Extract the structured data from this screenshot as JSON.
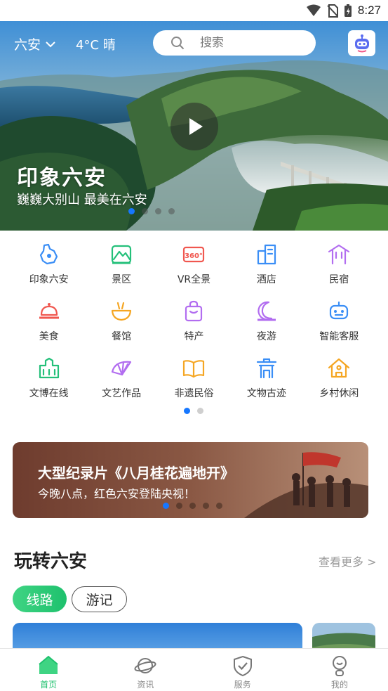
{
  "status_bar": {
    "time": "8:27"
  },
  "header": {
    "city": "六安",
    "weather": "4°C 晴",
    "search_placeholder": "搜索"
  },
  "hero": {
    "title": "印象六安",
    "subtitle": "巍巍大别山  最美在六安",
    "slide_count": 4,
    "active_slide": 0
  },
  "grid": {
    "rows": [
      [
        {
          "label": "印象六安",
          "icon": "map-region-icon",
          "color": "#3a8ef6"
        },
        {
          "label": "景区",
          "icon": "mountain-icon",
          "color": "#24c07a"
        },
        {
          "label": "VR全景",
          "icon": "vr-360-icon",
          "color": "#f0574f"
        },
        {
          "label": "酒店",
          "icon": "building-icon",
          "color": "#3a8ef6"
        },
        {
          "label": "民宿",
          "icon": "pavilion-icon",
          "color": "#b26df0"
        }
      ],
      [
        {
          "label": "美食",
          "icon": "cloche-icon",
          "color": "#f0574f"
        },
        {
          "label": "餐馆",
          "icon": "bowl-icon",
          "color": "#f5a623"
        },
        {
          "label": "特产",
          "icon": "gift-bag-icon",
          "color": "#b26df0"
        },
        {
          "label": "夜游",
          "icon": "moon-icon",
          "color": "#b26df0"
        },
        {
          "label": "智能客服",
          "icon": "robot-icon",
          "color": "#3a8ef6"
        }
      ],
      [
        {
          "label": "文博在线",
          "icon": "museum-icon",
          "color": "#24c07a"
        },
        {
          "label": "文艺作品",
          "icon": "fan-icon",
          "color": "#b26df0"
        },
        {
          "label": "非遗民俗",
          "icon": "book-icon",
          "color": "#f5a623"
        },
        {
          "label": "文物古迹",
          "icon": "archway-icon",
          "color": "#3a8ef6"
        },
        {
          "label": "乡村休闲",
          "icon": "house-icon",
          "color": "#f5a623"
        }
      ]
    ],
    "page_count": 2,
    "active_page": 0
  },
  "banner": {
    "title": "大型纪录片《八月桂花遍地开》",
    "subtitle": "今晚八点，红色六安登陆央视！",
    "slide_count": 5,
    "active_slide": 0
  },
  "section": {
    "title": "玩转六安",
    "more": "查看更多 >",
    "tabs": [
      {
        "label": "线路",
        "active": true
      },
      {
        "label": "游记",
        "active": false
      }
    ]
  },
  "tabbar": {
    "items": [
      {
        "label": "首页",
        "icon": "home-icon",
        "active": true
      },
      {
        "label": "资讯",
        "icon": "planet-icon",
        "active": false
      },
      {
        "label": "服务",
        "icon": "shield-check-icon",
        "active": false
      },
      {
        "label": "我的",
        "icon": "user-icon",
        "active": false
      }
    ]
  },
  "colors": {
    "accent_green": "#1ec16d",
    "accent_blue": "#1677ff"
  }
}
